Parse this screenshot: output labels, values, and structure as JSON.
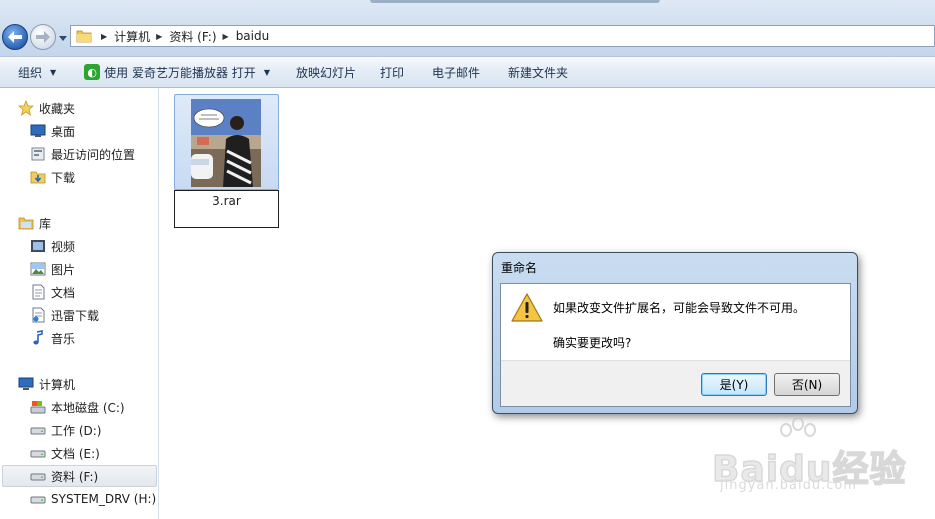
{
  "address_bar": {
    "crumbs": [
      "计算机",
      "资料 (F:)",
      "baidu"
    ]
  },
  "toolbar": {
    "organize": "组织",
    "open_with": "使用 爱奇艺万能播放器 打开",
    "slideshow": "放映幻灯片",
    "print": "打印",
    "email": "电子邮件",
    "new_folder": "新建文件夹"
  },
  "sidebar": {
    "favorites": {
      "header": "收藏夹",
      "items": [
        "桌面",
        "最近访问的位置",
        "下载"
      ]
    },
    "libraries": {
      "header": "库",
      "items": [
        "视频",
        "图片",
        "文档",
        "迅雷下载",
        "音乐"
      ]
    },
    "computer": {
      "header": "计算机",
      "items": [
        "本地磁盘 (C:)",
        "工作 (D:)",
        "文档 (E:)",
        "资料 (F:)",
        "SYSTEM_DRV (H:)"
      ],
      "selected": "资料 (F:)"
    }
  },
  "files": [
    {
      "name": "3.rar",
      "state": "renaming"
    }
  ],
  "dialog": {
    "title": "重命名",
    "message": "如果改变文件扩展名，可能会导致文件不可用。",
    "question": "确实要更改吗?",
    "yes_label": "是(Y)",
    "no_label": "否(N)"
  },
  "watermark": {
    "logo": "Baidu经验",
    "url": "jingyan.baidu.com"
  },
  "colors": {
    "accent": "#2a64b8",
    "selection": "#c8daf2",
    "toolbar_text": "#1e3351"
  }
}
